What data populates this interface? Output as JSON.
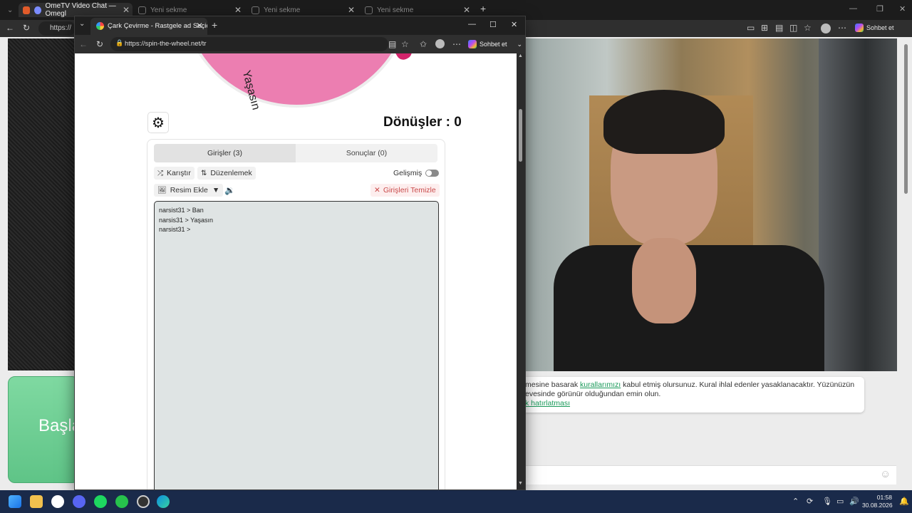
{
  "bg_browser": {
    "tabs": [
      {
        "label": "OmeTV Video Chat — Omegl",
        "active": true
      },
      {
        "label": "Yeni sekme",
        "active": false
      },
      {
        "label": "Yeni sekme",
        "active": false
      },
      {
        "label": "Yeni sekme",
        "active": false
      }
    ],
    "url": "https://",
    "chat_button": "Sohbet et",
    "start_button": "Başla",
    "rules": {
      "text1": "mesine basarak ",
      "link1": "kurallarımızı",
      "text1b": " kabul etmiş olursunuz. Kural ihlal edenler yasaklanacaktır. Yüzünüzün",
      "text2": "evesinde görünür olduğundan emin olun.",
      "link2": "k hatırlatması"
    }
  },
  "fg_browser": {
    "tab_title": "Çark Çevirme - Rastgele ad Seçici",
    "url": "https://spin-the-wheel.net/tr",
    "chat_button": "Sohbet et"
  },
  "wheel": {
    "segment_text": "Yaşasın",
    "segment_color": "#ec7eb1"
  },
  "spins": {
    "label": "Dönüşler",
    "value": "0"
  },
  "panel": {
    "tabs": [
      {
        "label": "Girişler (3)",
        "active": true
      },
      {
        "label": "Sonuçlar (0)",
        "active": false
      }
    ],
    "shuffle_label": "Karıştır",
    "sort_label": "Düzenlemek",
    "advanced_label": "Gelişmiş",
    "add_image_label": "Resim Ekle",
    "clear_label": "Girişleri Temizle",
    "entries": [
      "narsist31 > Ban",
      "narsis31 > Yaşasın",
      "narsist31 >"
    ]
  },
  "taskbar": {
    "time": "01:58",
    "date": "30.08.2026"
  },
  "colors": {
    "accent_green": "#5fc487",
    "clear_red": "#c94a4a",
    "wheel_pink": "#ec7eb1"
  }
}
